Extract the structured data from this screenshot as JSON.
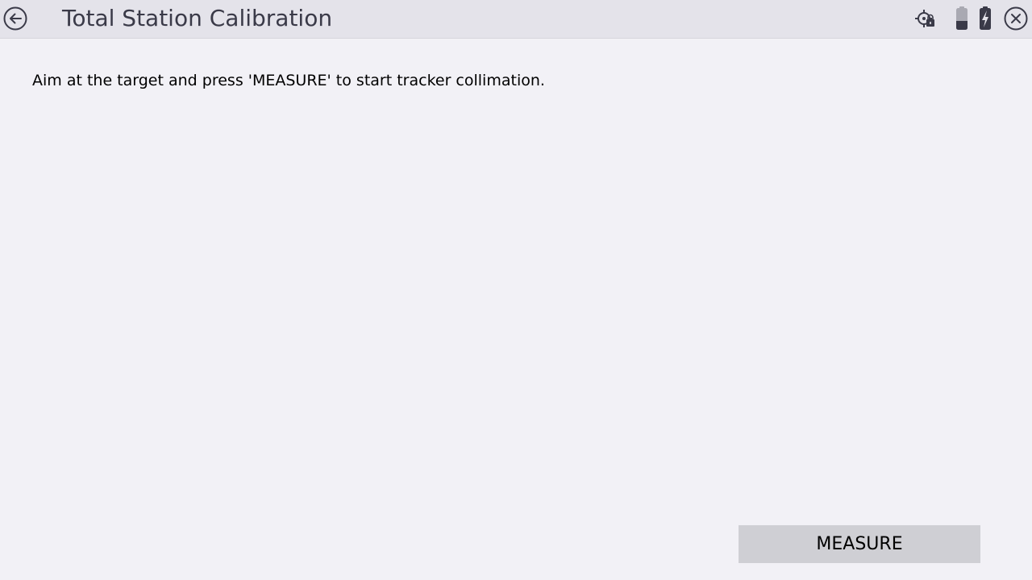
{
  "header": {
    "title": "Total Station Calibration",
    "back_icon": "back-arrow-icon",
    "close_icon": "close-icon",
    "status_icons": [
      "tracker-lock-icon",
      "battery-icon",
      "battery-charging-icon"
    ]
  },
  "main": {
    "instruction": "Aim at the target and press 'MEASURE' to start tracker collimation."
  },
  "footer": {
    "measure_label": "MEASURE"
  },
  "colors": {
    "background": "#f2f1f6",
    "header_background": "#e4e3ea",
    "icon": "#3a3a48",
    "button_background": "#cfcfd4"
  }
}
